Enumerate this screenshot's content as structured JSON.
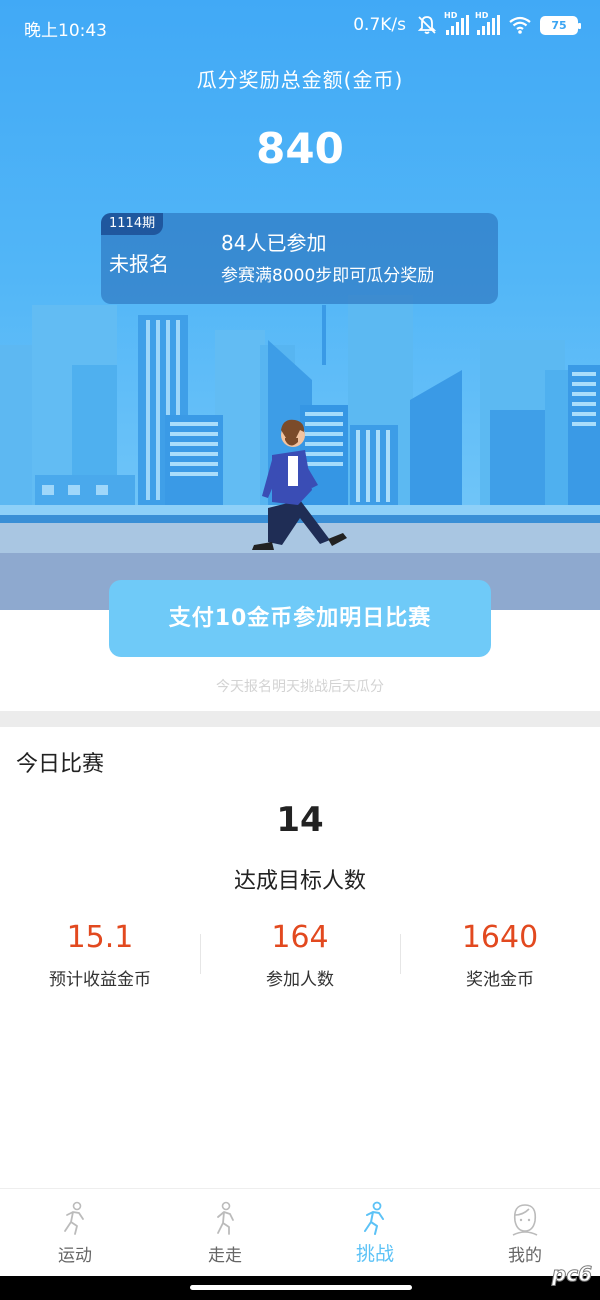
{
  "status_bar": {
    "time": "晚上10:43",
    "net_speed": "0.7K/s",
    "battery": "75",
    "icons": [
      "mute-bell-icon",
      "signal-hd-icon",
      "signal-hd-icon",
      "wifi-icon",
      "battery-icon"
    ]
  },
  "header": {
    "pool_title": "瓜分奖励总金额(金币)",
    "pool_amount": "840"
  },
  "period_card": {
    "period": "1114期",
    "registration_status": "未报名",
    "participants": "84人已参加",
    "rule": "参赛满8000步即可瓜分奖励"
  },
  "join": {
    "button_label": "支付10金币参加明日比赛",
    "hint": "今天报名明天挑战后天瓜分"
  },
  "today": {
    "title": "今日比赛",
    "goal_count": "14",
    "goal_label": "达成目标人数",
    "stats": [
      {
        "value": "15.1",
        "label": "预计收益金币"
      },
      {
        "value": "164",
        "label": "参加人数"
      },
      {
        "value": "1640",
        "label": "奖池金币"
      }
    ]
  },
  "tabbar": {
    "items": [
      {
        "label": "运动",
        "icon": "runner-icon",
        "active": false
      },
      {
        "label": "走走",
        "icon": "walker-icon",
        "active": false
      },
      {
        "label": "挑战",
        "icon": "challenge-runner-icon",
        "active": true
      },
      {
        "label": "我的",
        "icon": "profile-face-icon",
        "active": false
      }
    ]
  },
  "watermark": "pc6",
  "colors": {
    "hero_top": "#41a9f6",
    "button": "#6fcaf8",
    "accent_active": "#5cc2f6",
    "stat_value": "#e2491f"
  }
}
